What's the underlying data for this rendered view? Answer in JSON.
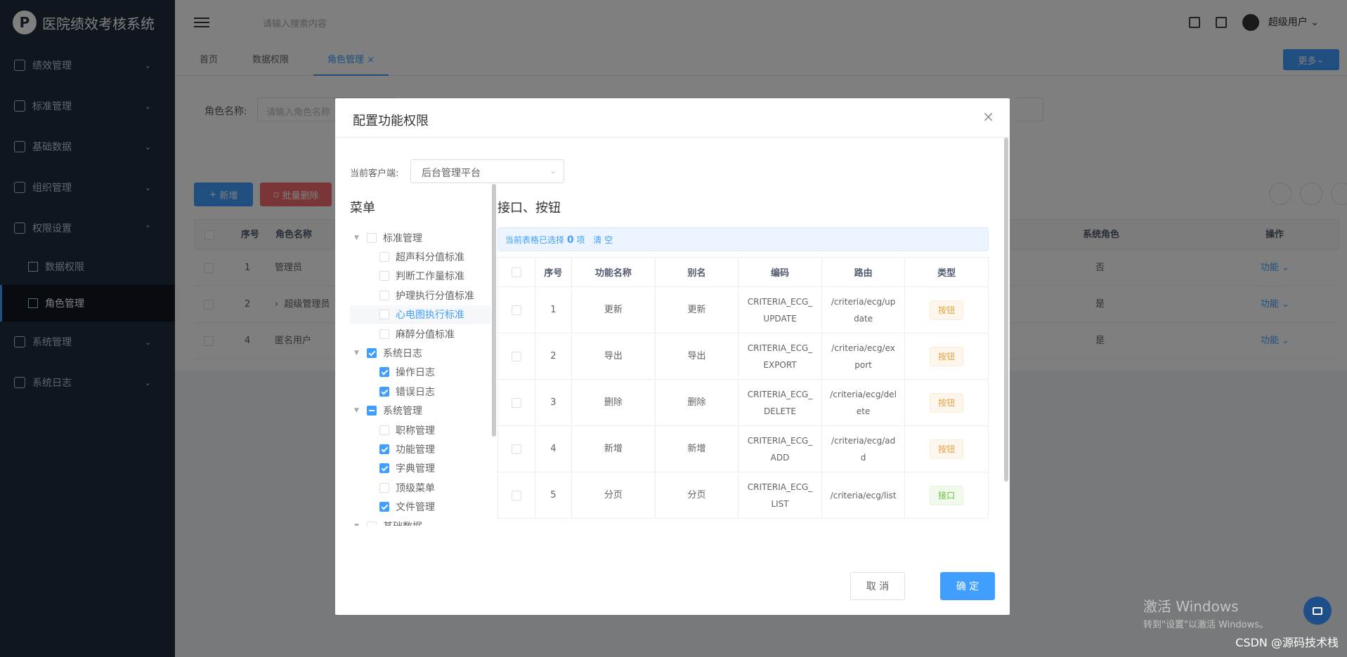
{
  "app": {
    "title": "医院绩效考核系统",
    "logo_letter": "P"
  },
  "sidebar": {
    "items": [
      {
        "label": "绩效管理",
        "icon": "document-icon"
      },
      {
        "label": "标准管理",
        "icon": "flag-icon"
      },
      {
        "label": "基础数据",
        "icon": "user-icon"
      },
      {
        "label": "组织管理",
        "icon": "tag-icon"
      },
      {
        "label": "权限设置",
        "icon": "shield-icon"
      },
      {
        "label": "系统管理",
        "icon": "gear-icon"
      },
      {
        "label": "系统日志",
        "icon": "log-icon"
      }
    ],
    "sub": [
      {
        "label": "数据权限",
        "icon": "bar-chart-icon"
      },
      {
        "label": "角色管理",
        "icon": "pin-icon"
      }
    ]
  },
  "header": {
    "search_placeholder": "请输入搜索内容",
    "user": "超级用户"
  },
  "tabs": [
    "首页",
    "数据权限",
    "角色管理"
  ],
  "tabs_more": "更多",
  "filter": {
    "label": "角色名称:",
    "placeholder": "请输入角色名称"
  },
  "toolbar": {
    "add": "新增",
    "batch_delete": "批量删除"
  },
  "table": {
    "headers": {
      "seq": "序号",
      "name": "角色名称",
      "system": "系统角色",
      "op": "操作"
    },
    "rows": [
      {
        "seq": "1",
        "name": "管理员",
        "system": "否",
        "op": "功能"
      },
      {
        "seq": "2",
        "name": "超级管理员",
        "system": "是",
        "op": "功能"
      },
      {
        "seq": "4",
        "name": "匿名用户",
        "system": "是",
        "op": "功能"
      }
    ]
  },
  "dialog": {
    "title": "配置功能权限",
    "client_label": "当前客户端:",
    "client_value": "后台管理平台",
    "menu_title": "菜单",
    "api_title": "接口、按钮",
    "selection": {
      "prefix": "当前表格已选择",
      "count": "0",
      "suffix": "项",
      "clear": "清 空"
    },
    "tree": [
      {
        "label": "标准管理",
        "level": 0,
        "state": "off",
        "arrow": true
      },
      {
        "label": "超声科分值标准",
        "level": 1,
        "state": "off"
      },
      {
        "label": "判断工作量标准",
        "level": 1,
        "state": "off"
      },
      {
        "label": "护理执行分值标准",
        "level": 1,
        "state": "off"
      },
      {
        "label": "心电图执行标准",
        "level": 1,
        "state": "off",
        "highlight": true
      },
      {
        "label": "麻醉分值标准",
        "level": 1,
        "state": "off"
      },
      {
        "label": "系统日志",
        "level": 0,
        "state": "on",
        "arrow": true
      },
      {
        "label": "操作日志",
        "level": 1,
        "state": "on"
      },
      {
        "label": "错误日志",
        "level": 1,
        "state": "on"
      },
      {
        "label": "系统管理",
        "level": 0,
        "state": "half",
        "arrow": true
      },
      {
        "label": "职称管理",
        "level": 1,
        "state": "off"
      },
      {
        "label": "功能管理",
        "level": 1,
        "state": "on"
      },
      {
        "label": "字典管理",
        "level": 1,
        "state": "on"
      },
      {
        "label": "顶级菜单",
        "level": 1,
        "state": "off"
      },
      {
        "label": "文件管理",
        "level": 1,
        "state": "on"
      },
      {
        "label": "基础数据",
        "level": 0,
        "state": "off",
        "arrow": true
      }
    ],
    "api_headers": [
      "序号",
      "功能名称",
      "别名",
      "编码",
      "路由",
      "类型"
    ],
    "api_rows": [
      {
        "seq": "1",
        "name": "更新",
        "alias": "更新",
        "code": "CRITERIA_ECG_UPDATE",
        "route": "/criteria/ecg/update",
        "type": "按钮",
        "kind": "btn"
      },
      {
        "seq": "2",
        "name": "导出",
        "alias": "导出",
        "code": "CRITERIA_ECG_EXPORT",
        "route": "/criteria/ecg/export",
        "type": "按钮",
        "kind": "btn"
      },
      {
        "seq": "3",
        "name": "删除",
        "alias": "删除",
        "code": "CRITERIA_ECG_DELETE",
        "route": "/criteria/ecg/delete",
        "type": "按钮",
        "kind": "btn"
      },
      {
        "seq": "4",
        "name": "新增",
        "alias": "新增",
        "code": "CRITERIA_ECG_ADD",
        "route": "/criteria/ecg/add",
        "type": "按钮",
        "kind": "btn"
      },
      {
        "seq": "5",
        "name": "分页",
        "alias": "分页",
        "code": "CRITERIA_ECG_LIST",
        "route": "/criteria/ecg/list",
        "type": "接口",
        "kind": "api"
      }
    ],
    "cancel": "取 消",
    "ok": "确 定"
  },
  "watermark": {
    "line1": "激活 Windows",
    "line2": "转到\"设置\"以激活 Windows。"
  },
  "credit": "CSDN @源码技术栈",
  "colors": {
    "primary": "#409eff",
    "danger": "#f56c6c",
    "sidebar": "#1f2d3d",
    "warning": "#e6a23c",
    "success": "#67c23a"
  }
}
